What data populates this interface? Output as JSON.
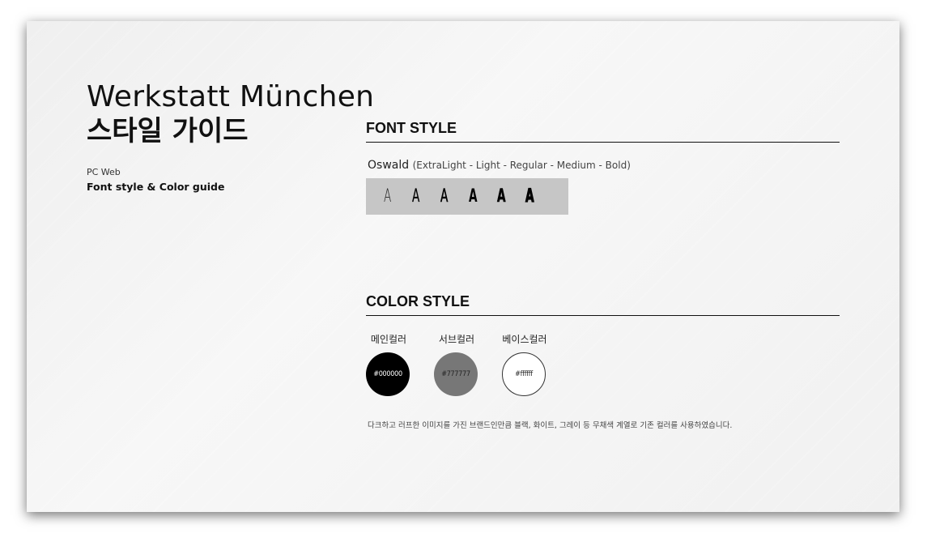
{
  "hero": {
    "title_en": "Werkstatt München",
    "title_ko": "스타일 가이드",
    "platform": "PC Web",
    "subtitle": "Font style & Color guide"
  },
  "font_style": {
    "heading": "FONT STYLE",
    "font_name": "Oswald",
    "weights": "(ExtraLight - Light - Regular - Medium - Bold)",
    "samples": [
      "A",
      "A",
      "A",
      "A",
      "A",
      "A"
    ]
  },
  "color_style": {
    "heading": "COLOR STYLE",
    "swatches": [
      {
        "label": "메인컬러",
        "hex": "#000000",
        "color": "#000000"
      },
      {
        "label": "서브컬러",
        "hex": "#777777",
        "color": "#777777"
      },
      {
        "label": "베이스컬러",
        "hex": "#ffffff",
        "color": "#ffffff"
      }
    ],
    "note": "다크하고 러프한 이미지를 가진 브랜드인만큼 블랙, 화이트, 그레이 등 무채색 계열로 기존 컬러를 사용하였습니다."
  }
}
